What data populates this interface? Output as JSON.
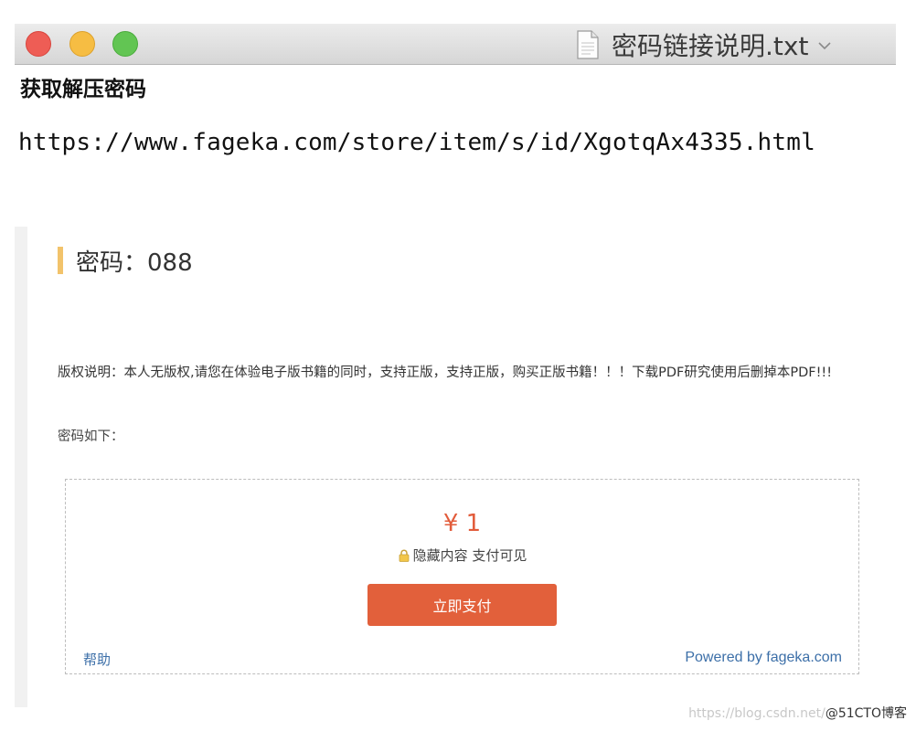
{
  "window": {
    "title": "密码链接说明.txt",
    "title_icon": "document-icon",
    "chevron_icon": "chevron-down-icon",
    "traffic_lights": [
      "close",
      "minimize",
      "zoom"
    ]
  },
  "document": {
    "heading": "获取解压密码",
    "url": "https://www.fageka.com/store/item/s/id/XgotqAx4335.html"
  },
  "page": {
    "password_title": "密码：088",
    "copyright": "版权说明：本人无版权,请您在体验电子版书籍的同时，支持正版，支持正版，购买正版书籍！！！下载PDF研究使用后删掉本PDF!!!",
    "password_below": "密码如下：",
    "paybox": {
      "price": "¥ 1",
      "hidden_text": "隐藏内容 支付可见",
      "lock_icon": "lock-icon",
      "pay_button": "立即支付",
      "help": "帮助",
      "powered_by": "Powered by fageka.com"
    }
  },
  "watermark": {
    "prefix": "https://blog.csdn.net/",
    "brand": "@51CTO博客"
  },
  "colors": {
    "accent": "#e2603b",
    "price": "#e25b3a",
    "link": "#3c6fa8",
    "title_accent": "#f2c36b"
  }
}
